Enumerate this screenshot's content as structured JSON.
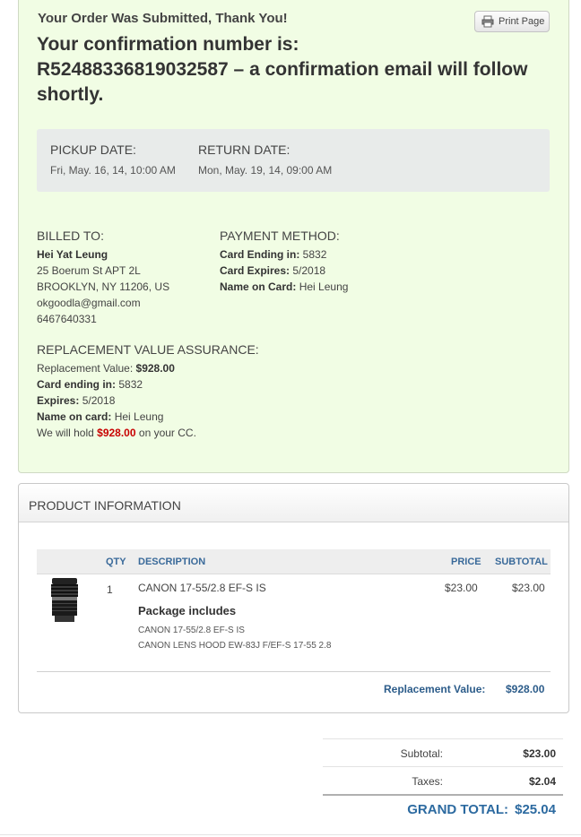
{
  "confirmation": {
    "thanks": "Your Order Was Submitted, Thank You!",
    "print_label": "Print Page",
    "headline_prefix": "Your confirmation number is:",
    "number": "R52488336819032587",
    "headline_suffix": " – a confirmation email will follow shortly."
  },
  "dates": {
    "pickup_label": "PICKUP DATE:",
    "pickup_value": "Fri, May. 16, 14, 10:00 AM",
    "return_label": "RETURN DATE:",
    "return_value": "Mon, May. 19, 14, 09:00 AM"
  },
  "billed": {
    "heading": "BILLED TO:",
    "name": "Hei Yat Leung",
    "street": "25 Boerum St APT 2L",
    "city": "BROOKLYN, NY 11206, US",
    "email": "okgoodla@gmail.com",
    "phone": "6467640331"
  },
  "payment": {
    "heading": "PAYMENT METHOD:",
    "card_ending_label": "Card Ending in:",
    "card_ending_value": "5832",
    "card_expires_label": "Card Expires:",
    "card_expires_value": "5/2018",
    "name_label": "Name on Card:",
    "name_value": "Hei Leung"
  },
  "rva": {
    "heading": "REPLACEMENT VALUE ASSURANCE:",
    "value_label": "Replacement Value:",
    "value": "$928.00",
    "card_label": "Card ending in:",
    "card_value": "5832",
    "expires_label": "Expires:",
    "expires_value": "5/2018",
    "name_label": "Name on card:",
    "name_value": "Hei Leung",
    "hold_prefix": "We will hold",
    "hold_amount": "$928.00",
    "hold_suffix": "on your CC."
  },
  "product": {
    "panel_title": "PRODUCT INFORMATION",
    "columns": {
      "qty": "QTY",
      "description": "DESCRIPTION",
      "price": "PRICE",
      "subtotal": "SUBTOTAL"
    },
    "item": {
      "qty": "1",
      "description": "CANON 17-55/2.8 EF-S IS",
      "price": "$23.00",
      "subtotal": "$23.00",
      "package_title": "Package includes",
      "package_items": [
        "CANON 17-55/2.8 EF-S IS",
        "CANON LENS HOOD EW-83J F/EF-S 17-55 2.8"
      ]
    },
    "replacement_label": "Replacement Value:",
    "replacement_value": "$928.00"
  },
  "totals": {
    "subtotal_label": "Subtotal:",
    "subtotal_value": "$23.00",
    "taxes_label": "Taxes:",
    "taxes_value": "$2.04",
    "grand_label": "GRAND TOTAL:",
    "grand_value": "$25.04"
  },
  "colors": {
    "confirm_bg": "#f1fde4",
    "accent_blue": "#2c6aa0",
    "hold_red": "#c80000"
  },
  "icons": [
    "printer-icon",
    "lens-thumbnail"
  ]
}
